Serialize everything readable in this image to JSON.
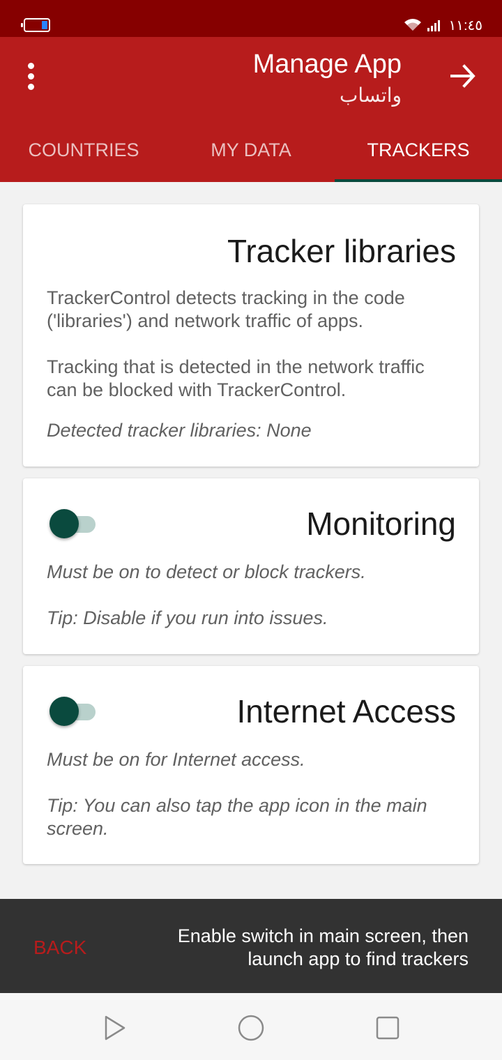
{
  "status_bar": {
    "time": "١١:٤٥",
    "battery_icon": "battery-icon",
    "wifi_icon": "wifi-icon",
    "signal_icon": "signal-icon"
  },
  "app_bar": {
    "title": "Manage App",
    "subtitle": "واتساب",
    "menu_icon": "more-vert-icon",
    "forward_icon": "arrow-forward-icon"
  },
  "tabs": [
    {
      "label": "COUNTRIES",
      "active": false
    },
    {
      "label": "MY DATA",
      "active": false
    },
    {
      "label": "TRACKERS",
      "active": true
    }
  ],
  "tracker_card": {
    "title": "Tracker libraries",
    "paragraph1": "TrackerControl detects tracking in the code ('libraries') and network traffic of apps.",
    "paragraph2": "Tracking that is detected in the network traffic can be blocked with TrackerControl.",
    "detected": "Detected tracker libraries: None"
  },
  "monitoring_card": {
    "title": "Monitoring",
    "enabled": true,
    "description": "Must be on to detect or block trackers.",
    "tip": "Tip: Disable if you run into issues."
  },
  "internet_card": {
    "title": "Internet Access",
    "enabled": true,
    "description": "Must be on for Internet access.",
    "tip": "Tip: You can also tap the app icon in the main screen."
  },
  "snackbar": {
    "action_label": "BACK",
    "message": "Enable switch in main screen, then launch app to find trackers"
  },
  "nav_bar": {
    "back_icon": "nav-back-icon",
    "home_icon": "nav-home-icon",
    "recents_icon": "nav-recents-icon"
  },
  "colors": {
    "status_bar": "#860000",
    "app_bar": "#b71c1c",
    "accent": "#0a4a3e",
    "snackbar": "#323232"
  }
}
